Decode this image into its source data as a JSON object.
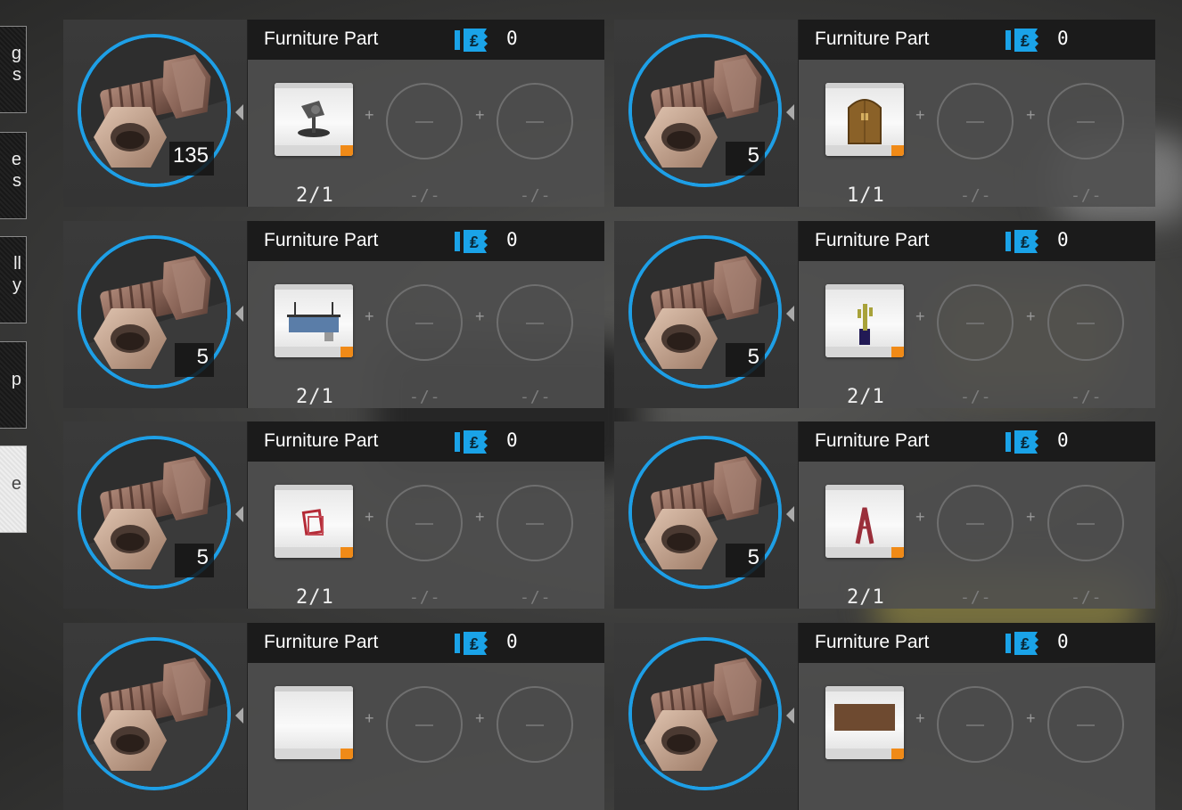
{
  "side_tabs": [
    {
      "label_l1": "g",
      "label_l2": "s"
    },
    {
      "label_l1": "e",
      "label_l2": "s"
    },
    {
      "label_l1": "ll",
      "label_l2": "y"
    },
    {
      "label_l1": "p",
      "label_l2": ""
    },
    {
      "label_l1": "e",
      "label_l2": ""
    }
  ],
  "cards": [
    {
      "title": "Furniture Part",
      "ticket_count": "0",
      "quantity": "135",
      "part": "lamp",
      "ratio": "2/1",
      "slot2": "-/-",
      "slot3": "-/-"
    },
    {
      "title": "Furniture Part",
      "ticket_count": "0",
      "quantity": "5",
      "part": "door",
      "ratio": "1/1",
      "slot2": "-/-",
      "slot3": "-/-"
    },
    {
      "title": "Furniture Part",
      "ticket_count": "0",
      "quantity": "5",
      "part": "shelf",
      "ratio": "2/1",
      "slot2": "-/-",
      "slot3": "-/-"
    },
    {
      "title": "Furniture Part",
      "ticket_count": "0",
      "quantity": "5",
      "part": "cactus",
      "ratio": "2/1",
      "slot2": "-/-",
      "slot3": "-/-"
    },
    {
      "title": "Furniture Part",
      "ticket_count": "0",
      "quantity": "5",
      "part": "frame",
      "ratio": "2/1",
      "slot2": "-/-",
      "slot3": "-/-"
    },
    {
      "title": "Furniture Part",
      "ticket_count": "0",
      "quantity": "5",
      "part": "easel",
      "ratio": "2/1",
      "slot2": "-/-",
      "slot3": "-/-"
    },
    {
      "title": "Furniture Part",
      "ticket_count": "0",
      "quantity": "",
      "part": "blank",
      "ratio": "",
      "slot2": "",
      "slot3": ""
    },
    {
      "title": "Furniture Part",
      "ticket_count": "0",
      "quantity": "",
      "part": "box",
      "ratio": "",
      "slot2": "",
      "slot3": ""
    }
  ],
  "colors": {
    "ring": "#1e9fe6",
    "ticket": "#1aa3e8",
    "tag": "#f08a17"
  }
}
